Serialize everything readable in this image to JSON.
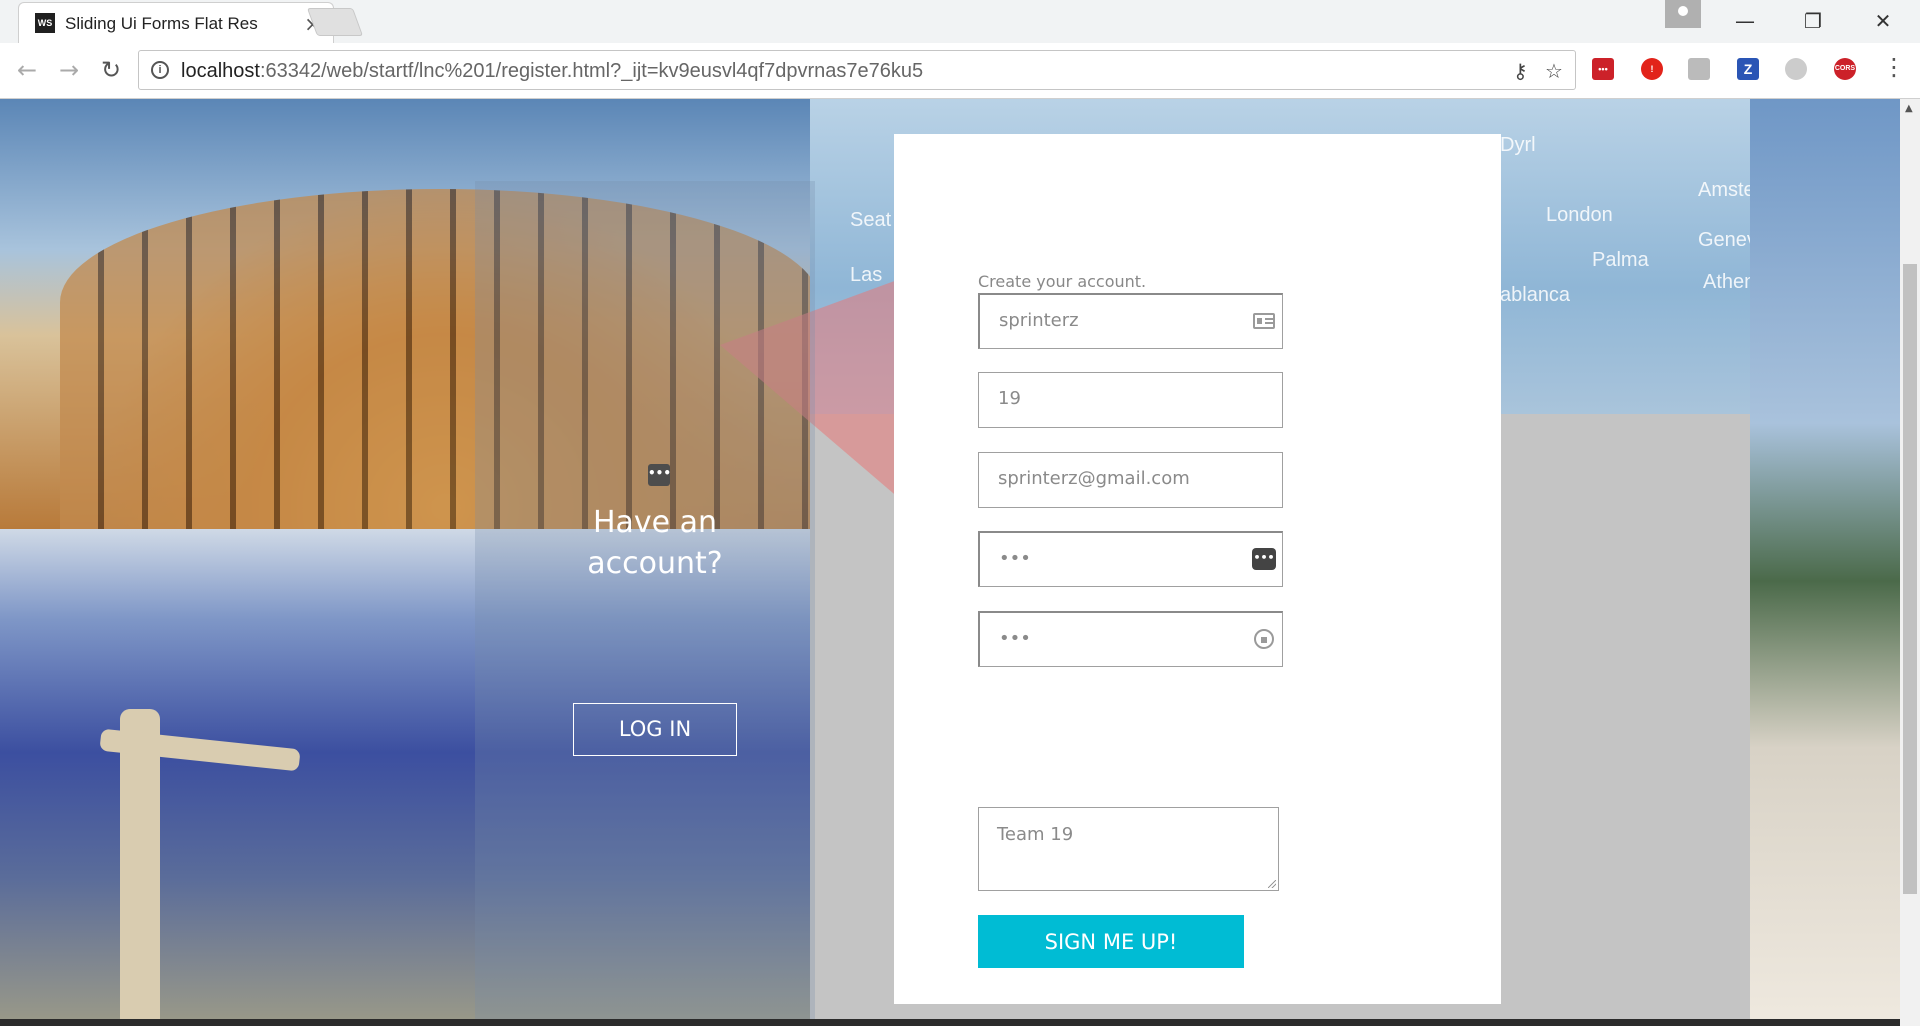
{
  "browser": {
    "tab_title": "Sliding Ui Forms Flat Res",
    "tab_close": "×",
    "favicon_text": "WS",
    "url_host": "localhost",
    "url_rest": ":63342/web/startf/lnc%201/register.html?_ijt=kv9eusvl4qf7dpvrnas7e76ku5",
    "window_controls": {
      "minimize": "—",
      "restore": "❐",
      "close": "✕"
    },
    "nav": {
      "back": "←",
      "forward": "→",
      "reload": "↻"
    },
    "extensions": [
      {
        "name": "lastpass-icon",
        "label": "•••",
        "color": "#cc2129"
      },
      {
        "name": "adblock-icon",
        "label": "!",
        "color": "#e2231a"
      },
      {
        "name": "shield-icon",
        "label": "",
        "color": "#bbbbbb"
      },
      {
        "name": "z-icon",
        "label": "Z",
        "color": "#2a55b5"
      },
      {
        "name": "sync-icon",
        "label": "",
        "color": "#cccccc"
      },
      {
        "name": "cors-icon",
        "label": "CORS",
        "color": "#cc2129"
      }
    ]
  },
  "background": {
    "map_labels": [
      "Seat",
      "Las",
      "London",
      "Amster",
      "Palma",
      "Geneva",
      "Athen",
      "ablanca",
      "Dyrl"
    ]
  },
  "left_panel": {
    "heading": "Have an account?",
    "login_label": "LOG IN"
  },
  "form": {
    "caption": "Create your account.",
    "username": "sprinterz",
    "age": "19",
    "email": "sprinterz@gmail.com",
    "password": "•••",
    "confirm_password": "•••",
    "team": "Team 19",
    "submit_label": "SIGN ME UP!"
  }
}
